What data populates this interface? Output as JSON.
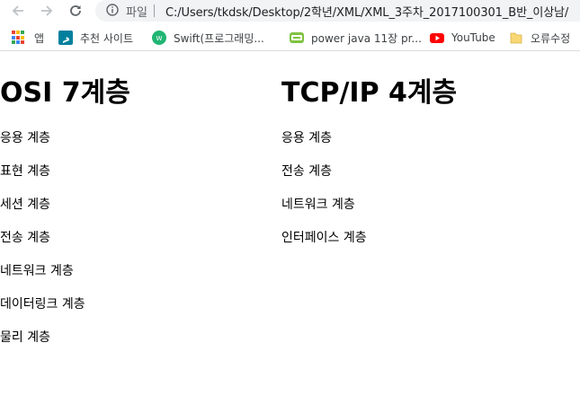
{
  "browser": {
    "scheme_label": "파일",
    "url": "C:/Users/tkdsk/Desktop/2학년/XML/XML_3주차_2017100301_B반_이상남/",
    "bookmarks": [
      {
        "label": "앱",
        "icon": "apps-grid-icon"
      },
      {
        "label": "추천 사이트",
        "icon": "bing-icon"
      },
      {
        "label": "Swift(프로그래밍...",
        "icon": "swift-icon"
      },
      {
        "label": "power java 11장 pr...",
        "icon": "blog-icon"
      },
      {
        "label": "YouTube",
        "icon": "youtube-icon"
      },
      {
        "label": "오류수정",
        "icon": "folder-icon"
      }
    ]
  },
  "page": {
    "osi": {
      "title": "OSI 7계층",
      "layers": [
        "응용 계층",
        "표현 계층",
        "세션 계층",
        "전송 계층",
        "네트워크 계층",
        "데이터링크 계층",
        "물리 계층"
      ]
    },
    "tcpip": {
      "title": "TCP/IP 4계층",
      "layers": [
        "응용 계층",
        "전송 계층",
        "네트워크 계층",
        "인터페이스 계층"
      ]
    }
  }
}
